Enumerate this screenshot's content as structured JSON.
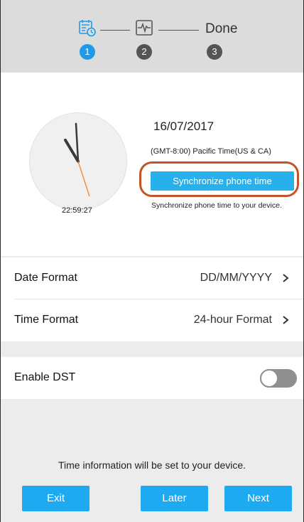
{
  "stepper": {
    "steps": [
      {
        "number": "1",
        "icon": "calendar-clock-icon",
        "state": "active"
      },
      {
        "number": "2",
        "icon": "heartbeat-monitor-icon",
        "state": "pending"
      },
      {
        "number": "3",
        "label": "Done",
        "state": "pending"
      }
    ],
    "active_color": "#1e9be8",
    "pending_color": "#555555"
  },
  "time_card": {
    "clock_time": "22:59:27",
    "date": "16/07/2017",
    "timezone": "(GMT-8:00) Pacific Time(US & CA)",
    "sync_button_label": "Synchronize phone time",
    "sync_hint": "Synchronize phone time to your device.",
    "highlight_color": "#c2542a",
    "second_hand_color": "#f08a3c"
  },
  "settings": {
    "date_format": {
      "label": "Date Format",
      "value": "DD/MM/YYYY"
    },
    "time_format": {
      "label": "Time Format",
      "value": "24-hour Format"
    },
    "dst": {
      "label": "Enable DST",
      "enabled": false
    }
  },
  "footer": {
    "note": "Time information will be set to your device.",
    "exit_label": "Exit",
    "later_label": "Later",
    "next_label": "Next",
    "button_color": "#1eaaf0"
  }
}
